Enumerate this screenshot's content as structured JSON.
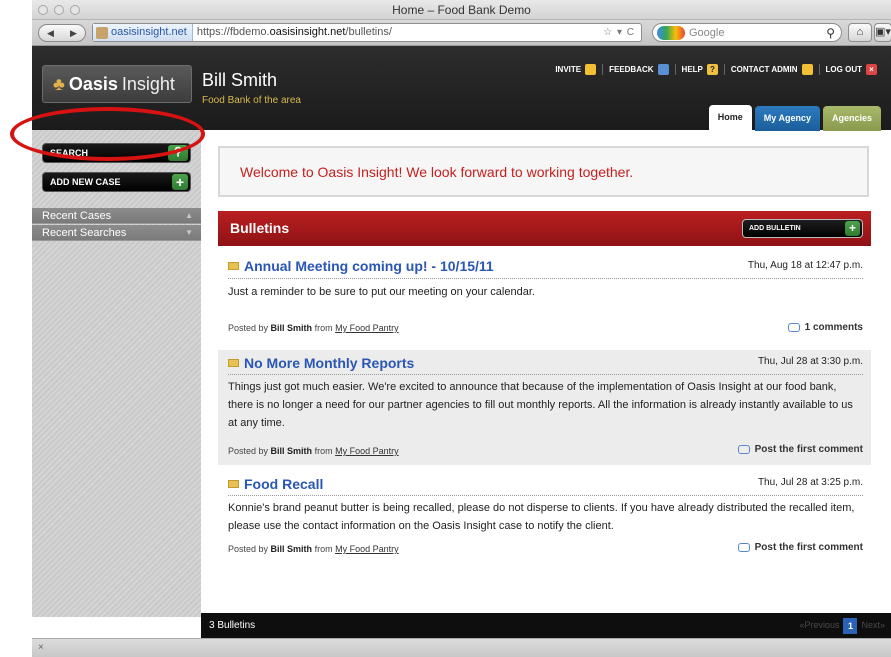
{
  "window": {
    "title": "Home – Food Bank Demo"
  },
  "browser": {
    "site_identity": "oasisinsight.net",
    "url_prefix": "https://fbdemo.",
    "url_domain": "oasisinsight.net",
    "url_path": "/bulletins/",
    "url_controls": "☆ ▾ C",
    "search_placeholder": "Google",
    "back_glyph": "◀",
    "forward_glyph": "▶",
    "home_glyph": "⌂",
    "bookmark_glyph": "▣▾",
    "close_glyph": "×"
  },
  "header": {
    "logo_bold": "Oasis",
    "logo_thin": "Insight",
    "user_name": "Bill Smith",
    "user_org": "Food Bank of the area",
    "nav": [
      "INVITE",
      "FEEDBACK",
      "HELP",
      "CONTACT ADMIN",
      "LOG OUT"
    ],
    "tabs": [
      "Home",
      "My Agency",
      "Agencies"
    ]
  },
  "sidebar": {
    "search_label": "SEARCH",
    "add_case_label": "ADD NEW CASE",
    "recent_cases": "Recent Cases",
    "recent_searches": "Recent Searches"
  },
  "welcome": "Welcome to Oasis Insight! We look forward to working together.",
  "bulletins": {
    "heading": "Bulletins",
    "add_label": "ADD BULLETIN",
    "posts": [
      {
        "title": "Annual Meeting coming up! - 10/15/11",
        "date": "Thu, Aug 18 at 12:47 p.m.",
        "body": "Just a reminder to be sure to put our meeting on your calendar.",
        "posted_by_prefix": "Posted by",
        "author": "Bill Smith",
        "from": "from",
        "agency": "My Food Pantry",
        "comments": "1 comments"
      },
      {
        "title": "No More Monthly Reports",
        "date": "Thu, Jul 28 at 3:30 p.m.",
        "body": "Things just got much easier. We're excited to announce that because of the implementation of Oasis Insight at our food bank, there is no longer a need for our partner agencies to fill out monthly reports. All the information is already instantly available to us at any time.",
        "posted_by_prefix": "Posted by",
        "author": "Bill Smith",
        "from": "from",
        "agency": "My Food Pantry",
        "comments": "Post the first comment"
      },
      {
        "title": "Food Recall",
        "date": "Thu, Jul 28 at 3:25 p.m.",
        "body": "Konnie's brand peanut butter is being recalled, please do not disperse to clients. If you have already distributed the recalled item, please use the contact information on the Oasis Insight case to notify the client.",
        "posted_by_prefix": "Posted by",
        "author": "Bill Smith",
        "from": "from",
        "agency": "My Food Pantry",
        "comments": "Post the first comment"
      }
    ],
    "count_label": "3 Bulletins",
    "pager_prev": "«Previous",
    "pager_current": "1",
    "pager_next": "Next»"
  },
  "colors": {
    "accent_red": "#b91f21",
    "link_blue": "#2a56b4",
    "annotation_red": "#d61212"
  }
}
